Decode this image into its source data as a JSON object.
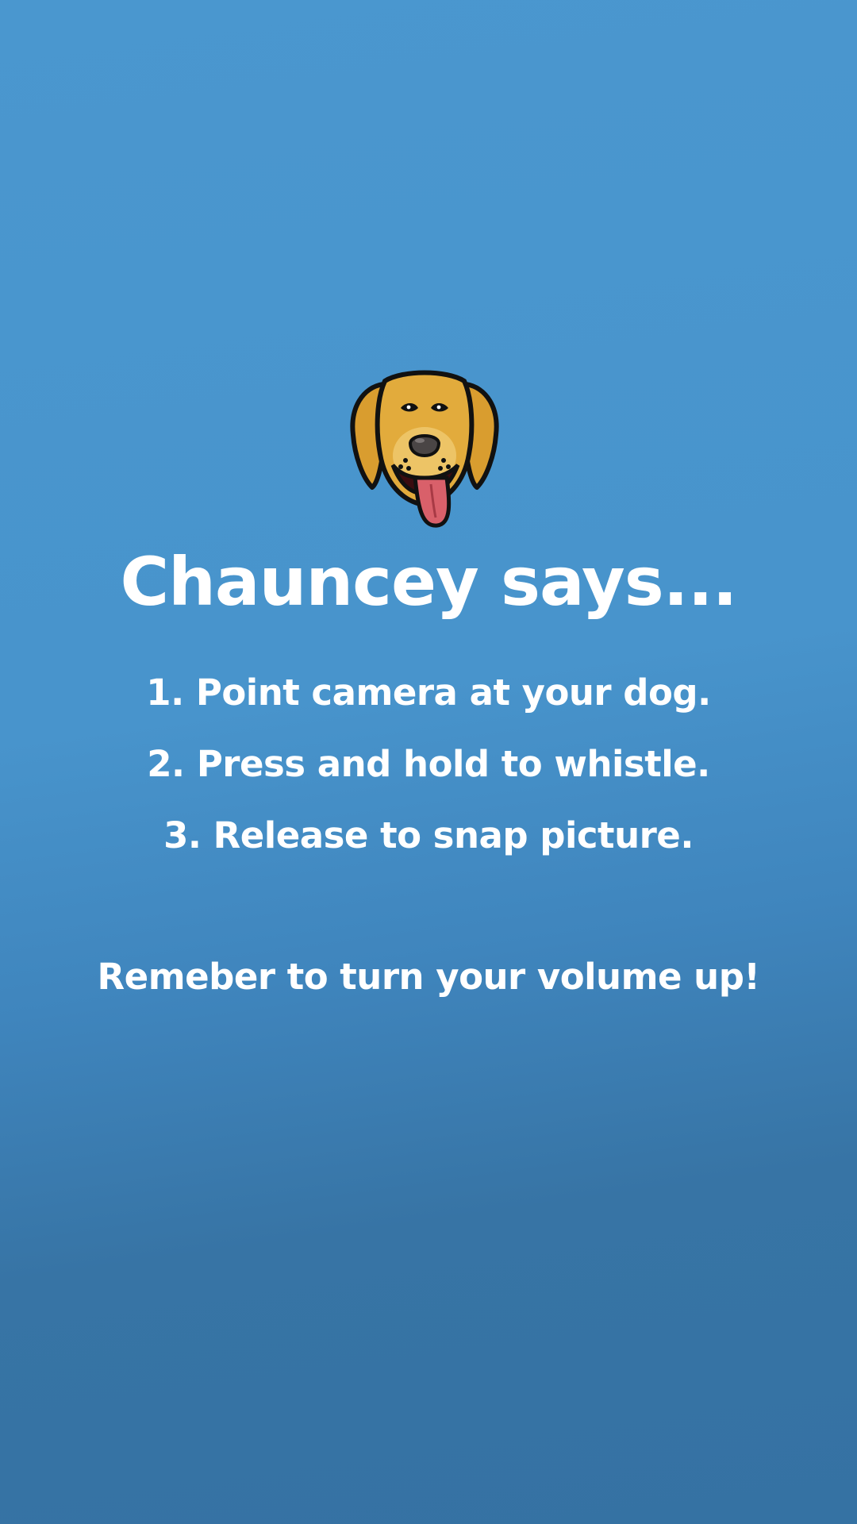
{
  "app": {
    "logo_icon": "dog-face-icon",
    "title": "Chauncey says...",
    "steps": [
      "1. Point camera at your dog.",
      "2. Press and hold to whistle.",
      "3. Release to snap picture."
    ],
    "reminder": "Remeber to turn your volume up!"
  },
  "colors": {
    "background_top": "#4a97cf",
    "background_bottom": "#3572a3",
    "text": "#ffffff",
    "dog_fur": "#e0a93a",
    "dog_tongue": "#d9606a"
  }
}
